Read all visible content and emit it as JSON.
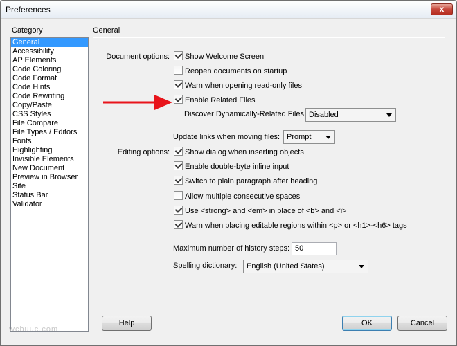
{
  "window": {
    "title": "Preferences",
    "close_symbol": "x"
  },
  "category": {
    "label": "Category",
    "items": [
      "General",
      "Accessibility",
      "AP Elements",
      "Code Coloring",
      "Code Format",
      "Code Hints",
      "Code Rewriting",
      "Copy/Paste",
      "CSS Styles",
      "File Compare",
      "File Types / Editors",
      "Fonts",
      "Highlighting",
      "Invisible Elements",
      "New Document",
      "Preview in Browser",
      "Site",
      "Status Bar",
      "Validator"
    ],
    "selected": "General"
  },
  "section": {
    "title": "General"
  },
  "document_options": {
    "label": "Document options:",
    "show_welcome": {
      "label": "Show Welcome Screen",
      "checked": true
    },
    "reopen_docs": {
      "label": "Reopen documents on startup",
      "checked": false
    },
    "warn_readonly": {
      "label": "Warn when opening read-only files",
      "checked": true
    },
    "enable_related": {
      "label": "Enable Related Files",
      "checked": true
    },
    "discover": {
      "label": "Discover Dynamically-Related Files:",
      "value": "Disabled"
    },
    "update_links": {
      "label": "Update links when moving files:",
      "value": "Prompt"
    }
  },
  "editing_options": {
    "label": "Editing options:",
    "show_dialog": {
      "label": "Show dialog when inserting objects",
      "checked": true
    },
    "double_byte": {
      "label": "Enable double-byte inline input",
      "checked": true
    },
    "plain_paragraph": {
      "label": "Switch to plain paragraph after heading",
      "checked": true
    },
    "multiple_spaces": {
      "label": "Allow multiple consecutive spaces",
      "checked": false
    },
    "strong_em": {
      "label": "Use <strong> and <em> in place of <b> and <i>",
      "checked": true
    },
    "warn_editable": {
      "label": "Warn when placing editable regions within <p> or <h1>-<h6> tags",
      "checked": true
    }
  },
  "history": {
    "label": "Maximum number of history steps:",
    "value": "50"
  },
  "spelling": {
    "label": "Spelling dictionary:",
    "value": "English (United States)"
  },
  "buttons": {
    "help": "Help",
    "ok": "OK",
    "cancel": "Cancel"
  },
  "watermark": "wcbuuc.com",
  "colors": {
    "arrow": "#e8141b",
    "selection": "#3399ff"
  }
}
